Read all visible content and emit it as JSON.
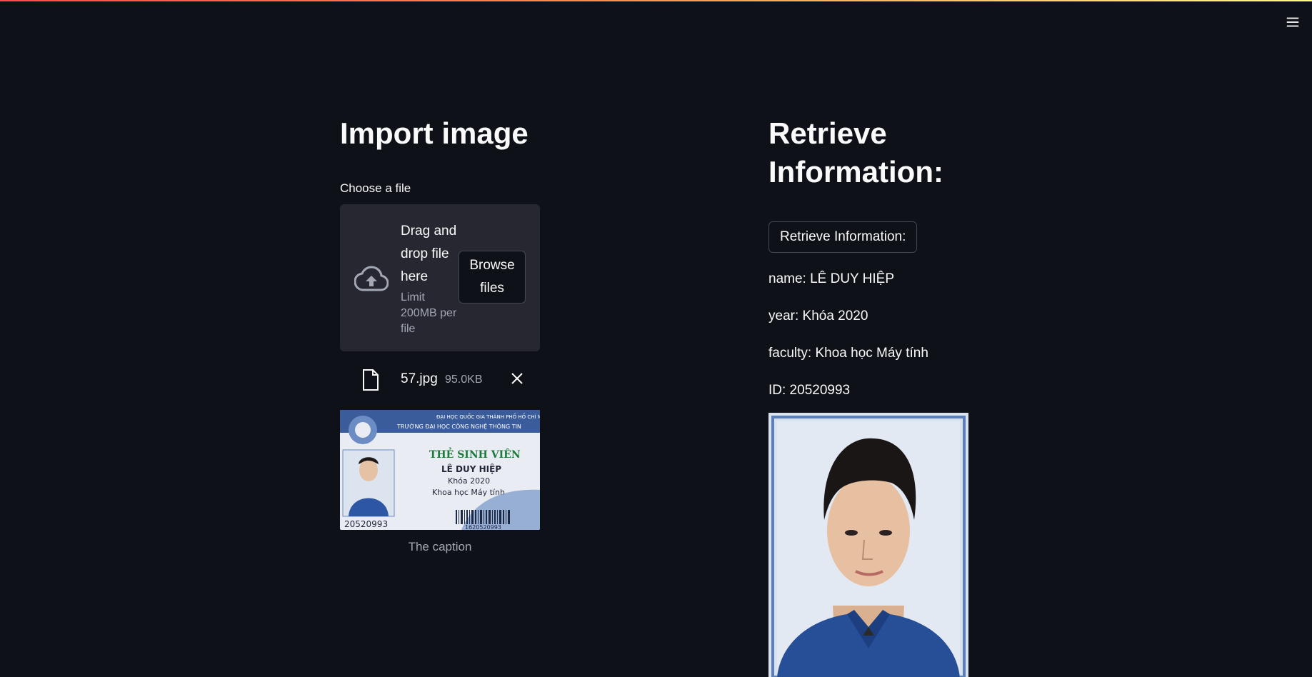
{
  "header": {
    "menu_icon": "hamburger-icon"
  },
  "left": {
    "title": "Import image",
    "uploader": {
      "label": "Choose a file",
      "drag_text": "Drag and drop file here",
      "limit_text": "Limit 200MB per file",
      "browse_label": "Browse files"
    },
    "file": {
      "name": "57.jpg",
      "size": "95.0KB"
    },
    "image": {
      "university": "ĐẠI HỌC QUỐC GIA THÀNH PHỐ HỒ CHÍ MINH",
      "school": "TRƯỜNG ĐẠI HỌC CÔNG NGHỆ THÔNG TIN",
      "card_title": "THẺ SINH VIÊN",
      "student_name": "LÊ DUY HIỆP",
      "student_year": "Khóa 2020",
      "student_faculty": "Khoa học Máy tính",
      "student_id": "20520993",
      "barcode_number": "1620520993"
    },
    "caption": "The caption"
  },
  "right": {
    "title": "Retrieve Information:",
    "button_label": "Retrieve Information:",
    "info": {
      "name": "name: LÊ DUY HIỆP",
      "year": "year: Khóa 2020",
      "faculty": "faculty: Khoa học Máy tính",
      "id": "ID: 20520993"
    }
  },
  "colors": {
    "background": "#0e1117",
    "panel": "#262730",
    "muted_text": "#a3a8b4",
    "card_green": "#1a7a3a",
    "card_blue": "#2f5fa8"
  }
}
